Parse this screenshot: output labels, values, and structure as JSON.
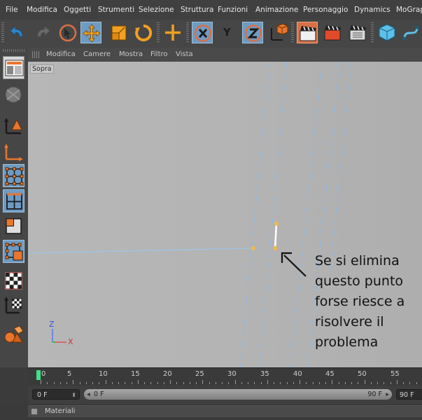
{
  "menu": [
    "File",
    "Modifica",
    "Oggetti",
    "Strumenti",
    "Selezione",
    "Struttura",
    "Funzioni",
    "Animazione",
    "Personaggio",
    "Dynamics",
    "MoGraph"
  ],
  "viewport": {
    "menu": [
      "Modifica",
      "Camere",
      "Mostra",
      "Filtro",
      "Vista"
    ],
    "view_label": "Sopra",
    "axis": {
      "z": "Z",
      "x": "X"
    }
  },
  "annotation": {
    "lines": [
      "Se si elimina",
      "questo punto",
      "forse riesce a",
      "risolvere il",
      "problema"
    ]
  },
  "toolbar": {
    "y_label": "Y"
  },
  "timeline": {
    "ticks": [
      "0",
      "5",
      "10",
      "15",
      "20",
      "25",
      "30",
      "35",
      "40",
      "45",
      "50",
      "55"
    ]
  },
  "range": {
    "start": "0 F",
    "slider_start": "0 F",
    "slider_end": "90 F",
    "end": "90 F"
  },
  "panel": {
    "title": "Materiali"
  },
  "colors": {
    "accent_blue": "#6e9bc3",
    "accent_orange": "#d87046",
    "playhead": "#3fe28a",
    "point": "#f2b84a",
    "guide": "#8fb9e4"
  }
}
